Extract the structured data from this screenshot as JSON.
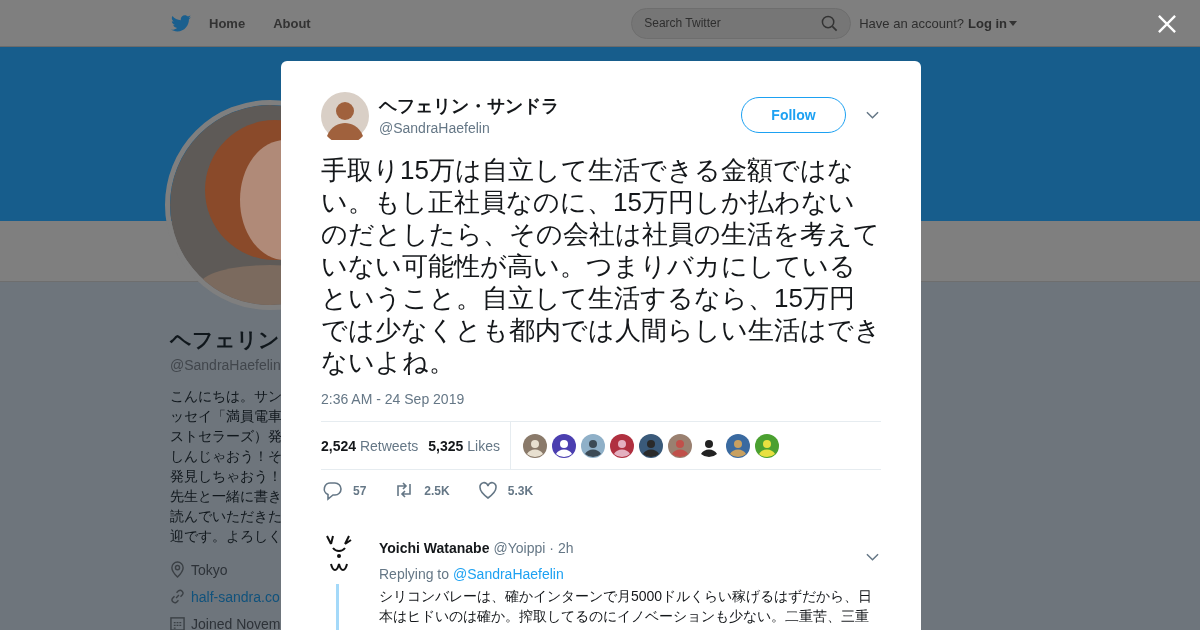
{
  "top_nav": {
    "items": [
      {
        "label": "Home"
      },
      {
        "label": "About"
      }
    ],
    "search": {
      "placeholder": "Search Twitter"
    },
    "account_prompt": "Have an account?",
    "login": "Log in"
  },
  "profile": {
    "name": "ヘフェリン",
    "handle": "@SandraHaefelin",
    "bio_lines": [
      "こんにちは。サン",
      "ッセイ「満員電車",
      "ストセラーズ）発",
      "しんじゃおう！そ",
      "発見しちゃおう！",
      "先生と一緒に書き",
      "読んでいただきた",
      "迎です。よろしく"
    ],
    "location": "Tokyo",
    "website": "half-sandra.co",
    "joined": "Joined Novem"
  },
  "tweet": {
    "author": {
      "name": "ヘフェリン・サンドラ",
      "handle": "@SandraHaefelin"
    },
    "follow": "Follow",
    "text": "手取り15万は自立して生活できる金額ではない。もし正社員なのに、15万円しか払わないのだとしたら、その会社は社員の生活を考えていない可能性が高い。つまりバカにしているということ。自立して生活するなら、15万円では少なくとも都内では人間らしい生活はできないよね。",
    "timestamp": "2:36 AM - 24 Sep 2019",
    "stats": [
      {
        "count": "2,524",
        "label": "Retweets"
      },
      {
        "count": "5,325",
        "label": "Likes"
      }
    ],
    "actions": [
      {
        "kind": "reply",
        "count": "57"
      },
      {
        "kind": "retweet",
        "count": "2.5K"
      },
      {
        "kind": "like",
        "count": "5.3K"
      }
    ]
  },
  "replies": [
    {
      "name": "Yoichi Watanabe",
      "handle": "@Yoippi",
      "separator": "·",
      "time": "2h",
      "replying_label": "Replying to",
      "replying_to": "@SandraHaefelin",
      "text": "シリコンバレーは、確かインターンで月5000ドルくらい稼げるはずだから、日本はヒドいのは確か。搾取してるのにイノベーションも少ない。二重苦、三重"
    }
  ]
}
